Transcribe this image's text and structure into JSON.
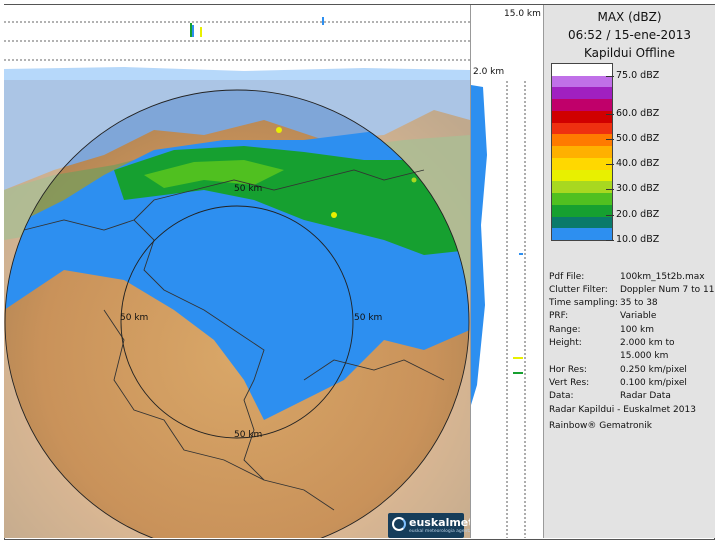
{
  "panel": {
    "title_product": "MAX (dBZ)",
    "title_datetime": "06:52 / 15-ene-2013",
    "title_radar": "Kapildui Offline"
  },
  "legend": {
    "labels": [
      "75.0 dBZ",
      "60.0 dBZ",
      "50.0 dBZ",
      "40.0 dBZ",
      "30.0 dBZ",
      "20.0 dBZ",
      "10.0 dBZ"
    ],
    "colors": [
      "#ffffff",
      "#c070e8",
      "#a020c0",
      "#c0006a",
      "#d00000",
      "#ee3010",
      "#ff7a00",
      "#ffb000",
      "#ffd800",
      "#e8f000",
      "#a8d820",
      "#50c020",
      "#16a030",
      "#0a7a6a",
      "#2d8ff0"
    ]
  },
  "info": [
    {
      "label": "Pdf File:",
      "value": "100km_15t2b.max"
    },
    {
      "label": "Clutter Filter:",
      "value": "Doppler Num 7 to 11"
    },
    {
      "label": "Time sampling:",
      "value": "35 to 38"
    },
    {
      "label": "PRF:",
      "value": "Variable"
    },
    {
      "label": "Range:",
      "value": "100 km"
    },
    {
      "label": "Height:",
      "value": "2.000 km to"
    },
    {
      "label": "",
      "value": "15.000 km"
    },
    {
      "label": "Hor Res:",
      "value": "0.250 km/pixel"
    },
    {
      "label": "Vert Res:",
      "value": "0.100 km/pixel"
    },
    {
      "label": "Data:",
      "value": "Radar Data"
    }
  ],
  "credits": {
    "line1": "Radar Kapildui - Euskalmet 2013",
    "line2": "Rainbow® Gematronik"
  },
  "scale": {
    "top_height": "15.0 km",
    "low_height": "2.0 km",
    "ring_label_top": "50 km",
    "ring_label_left": "50 km",
    "ring_label_right": "50 km",
    "ring_label_bottom": "50 km"
  },
  "logo": {
    "text": "euskalmet",
    "subtitle": "euskal meteorologia agentzia"
  },
  "colors": {
    "panel_bg": "#e3e3e3",
    "sea": "#7fa6d8",
    "echo_blue": "#2d8ff0",
    "echo_green": "#16a030",
    "terrain_tan": "#c9925a",
    "outside_range": "#ffffff"
  }
}
